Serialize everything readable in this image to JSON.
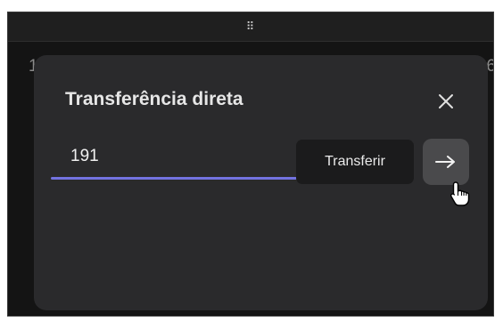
{
  "window": {
    "grip_icon": "drag-handle-icon",
    "edge_left_digit": "1",
    "edge_right_digit": "6"
  },
  "dialog": {
    "title": "Transferência direta",
    "close_icon": "close-icon",
    "input": {
      "value": "191",
      "placeholder": ""
    },
    "tooltip": "Transferir",
    "submit_icon": "arrow-right-icon"
  },
  "colors": {
    "accent": "#7373e0",
    "dialog_bg": "#2a2a2c",
    "page_bg": "#141414"
  }
}
